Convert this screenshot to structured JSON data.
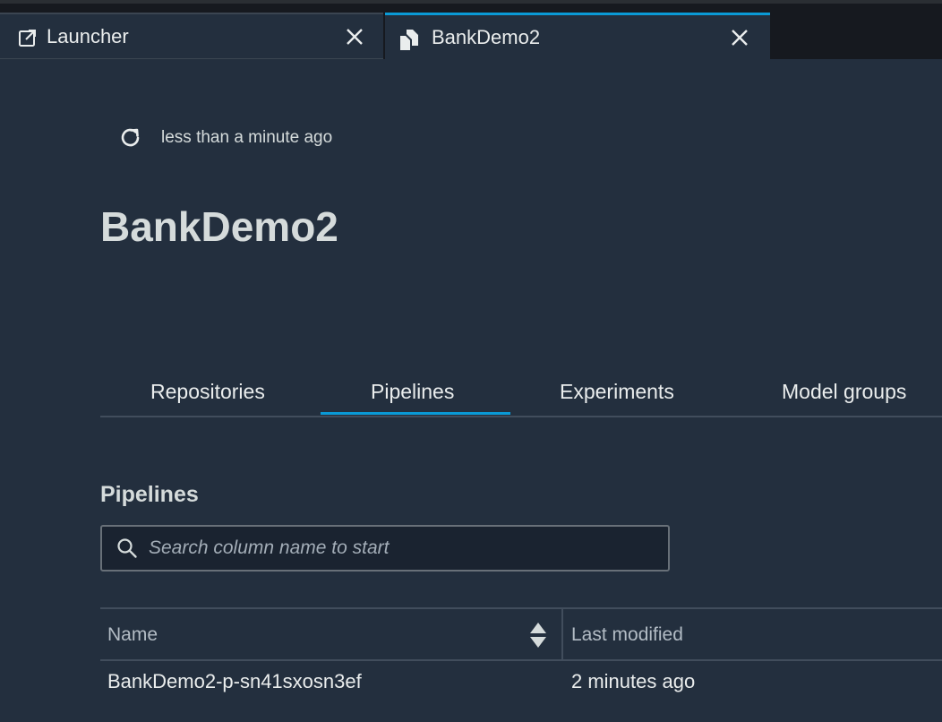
{
  "tabs": [
    {
      "label": "Launcher",
      "icon": "launch-icon"
    },
    {
      "label": "BankDemo2",
      "icon": "project-icon",
      "active": true
    }
  ],
  "refresh": {
    "icon": "refresh-icon",
    "text": "less than a minute ago"
  },
  "page_title": "BankDemo2",
  "content_tabs": {
    "items": [
      "Repositories",
      "Pipelines",
      "Experiments",
      "Model groups"
    ],
    "selected": "Pipelines"
  },
  "section": {
    "title": "Pipelines",
    "search_placeholder": "Search column name to start"
  },
  "table": {
    "columns": [
      "Name",
      "Last modified"
    ],
    "rows": [
      {
        "name": "BankDemo2-p-sn41sxosn3ef",
        "last_modified": "2 minutes ago"
      }
    ]
  },
  "colors": {
    "background": "#232f3e",
    "accent": "#0a9ad6",
    "text": "#d5dbdb"
  }
}
